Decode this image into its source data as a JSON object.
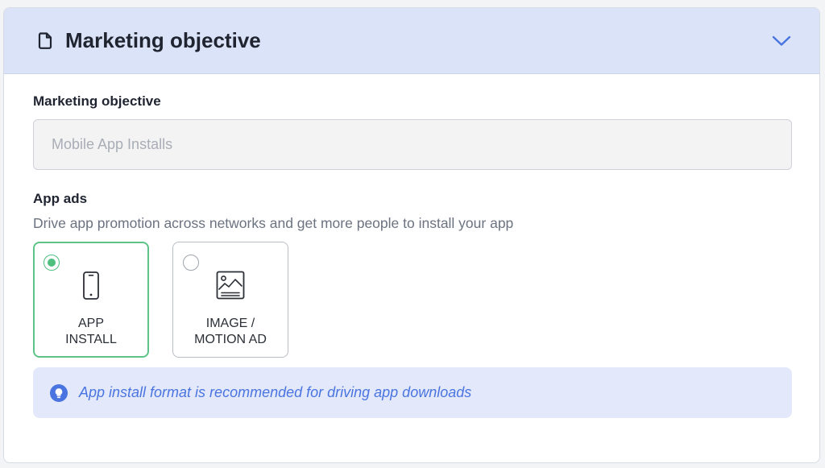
{
  "panel": {
    "title": "Marketing objective",
    "title_icon": "document-icon",
    "toggle_icon": "chevron-down-icon"
  },
  "objective_field": {
    "label": "Marketing objective",
    "value": "Mobile App Installs"
  },
  "app_ads": {
    "label": "App ads",
    "description": "Drive app promotion across networks and get more people to install your app",
    "options": [
      {
        "line1": "APP",
        "line2": "INSTALL",
        "icon": "mobile-phone-icon",
        "selected": true
      },
      {
        "line1": "IMAGE /",
        "line2": "MOTION AD",
        "icon": "image-icon",
        "selected": false
      }
    ]
  },
  "info": {
    "icon": "lightbulb-icon",
    "text": "App install format is recommended for driving app downloads"
  },
  "colors": {
    "header_bg": "#dae3f7",
    "selected_border": "#5dc389",
    "info_bg": "#e3e9fb",
    "info_text": "#4a74df",
    "chevron": "#4a74df"
  }
}
